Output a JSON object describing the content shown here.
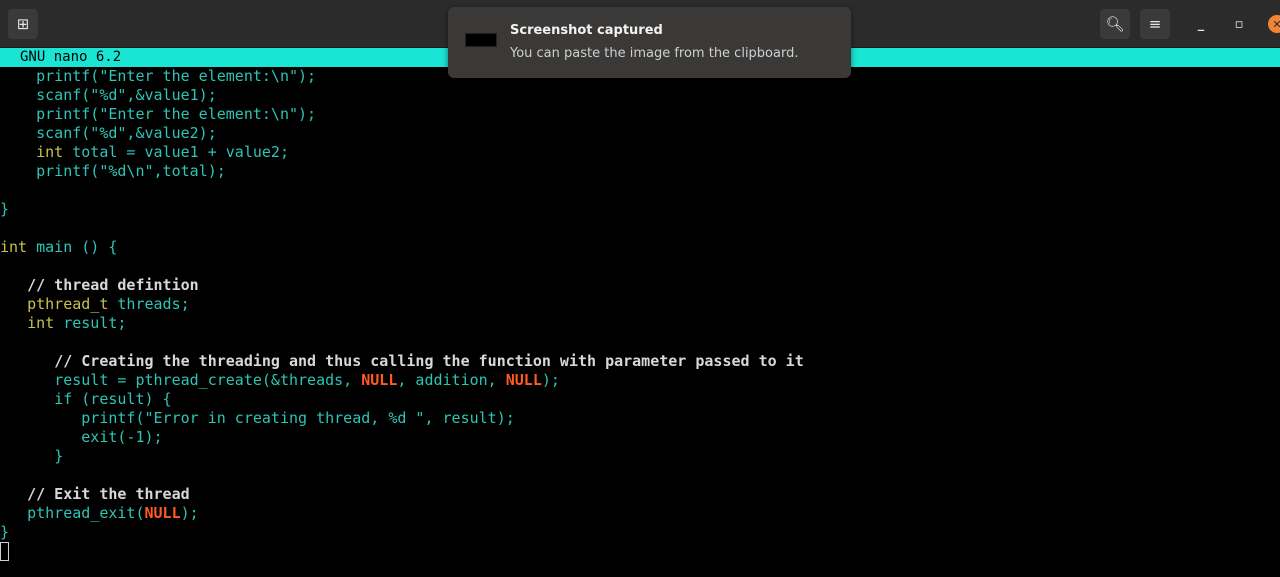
{
  "titlebar": {
    "new_tab_icon": "new-tab-icon",
    "search_icon": "search-icon",
    "menu_icon": "hamburger-menu-icon",
    "minimize_icon": "minimize-icon",
    "maximize_icon": "maximize-icon",
    "close_icon": "close-icon",
    "accent_color": "#f08437"
  },
  "nano": {
    "version_label": "GNU nano 6.2",
    "bar_color": "#1ae4d4"
  },
  "notification": {
    "title": "Screenshot captured",
    "body": "You can paste the image from the clipboard."
  },
  "code": {
    "l1_a": "    printf(\"Enter the element:\\n\");",
    "l2_a": "    scanf(\"%d\",&value1);",
    "l3_a": "    printf(\"Enter the element:\\n\");",
    "l4_a": "    scanf(\"%d\",&value2);",
    "l5_kw": "int",
    "l5_rest": " total = value1 + value2;",
    "l6_a": "    printf(\"%d\\n\",total);",
    "l8_a": "}",
    "l10_kw": "int",
    "l10_rest": " main () {",
    "l12_comment": "// thread defintion",
    "l13_kw": "pthread_t",
    "l13_rest": " threads;",
    "l14_kw": "int",
    "l14_rest": " result;",
    "l16_comment": "// Creating the threading and thus calling the function with parameter passed to it",
    "l17_a": "result = pthread_create(&threads, ",
    "l17_null1": "NULL",
    "l17_b": ", addition, ",
    "l17_null2": "NULL",
    "l17_c": ");",
    "l18_a": "if (result) {",
    "l19_a": "printf(\"Error in creating thread, %d \", result);",
    "l20_a": "exit(-1);",
    "l21_a": "}",
    "l23_comment": "// Exit the thread",
    "l24_a": "pthread_exit(",
    "l24_null": "NULL",
    "l24_b": ");",
    "l25_a": "}"
  }
}
